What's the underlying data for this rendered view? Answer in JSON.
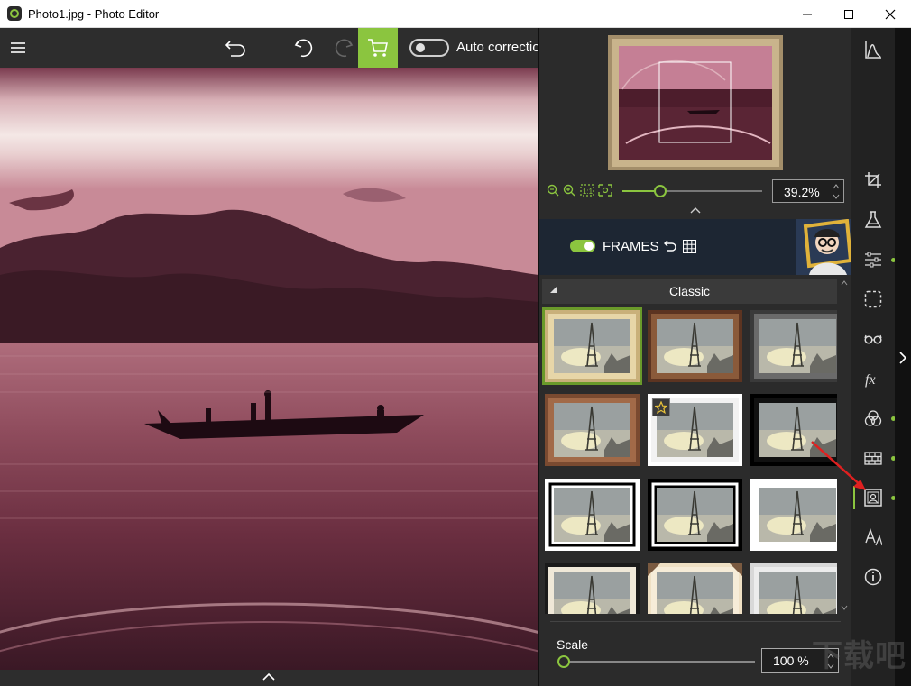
{
  "window": {
    "title": "Photo1.jpg - Photo Editor"
  },
  "toolbar": {
    "auto_correction_label": "Auto correction",
    "auto_correction_enabled": false
  },
  "navigator": {
    "zoom_value": "39.2%",
    "zoom_fraction": 0.27
  },
  "frames": {
    "title": "FRAMES",
    "enabled": true,
    "category": "Classic",
    "thumbnails": [
      {
        "style": "gold-wood",
        "selected": true,
        "favorite": false
      },
      {
        "style": "dark-wood",
        "selected": false,
        "favorite": false
      },
      {
        "style": "black-metal",
        "selected": false,
        "favorite": false
      },
      {
        "style": "brown-wood",
        "selected": false,
        "favorite": false
      },
      {
        "style": "white-mat",
        "selected": false,
        "favorite": true
      },
      {
        "style": "black-thin",
        "selected": false,
        "favorite": false
      },
      {
        "style": "white-black-edge",
        "selected": false,
        "favorite": false
      },
      {
        "style": "black-white-edge",
        "selected": false,
        "favorite": false
      },
      {
        "style": "thin-white",
        "selected": false,
        "favorite": false
      },
      {
        "style": "dark-cream",
        "selected": false,
        "favorite": false
      },
      {
        "style": "cream-corners",
        "selected": false,
        "favorite": false
      },
      {
        "style": "light-grey",
        "selected": false,
        "favorite": false
      }
    ]
  },
  "scale": {
    "label": "Scale",
    "value": "100 %",
    "fraction": 0.0
  },
  "side_icons": [
    "histogram-icon",
    "crop-icon",
    "flask-icon",
    "adjust-sliders-icon",
    "selection-icon",
    "glasses-icon",
    "fx-icon",
    "color-circles-icon",
    "texture-icon",
    "frame-portrait-icon",
    "text-effects-icon",
    "info-icon"
  ],
  "watermark": "下载吧",
  "colors": {
    "accent": "#8bc53f",
    "panel": "#2b2b2b",
    "toolbar": "#2d2d2d"
  }
}
